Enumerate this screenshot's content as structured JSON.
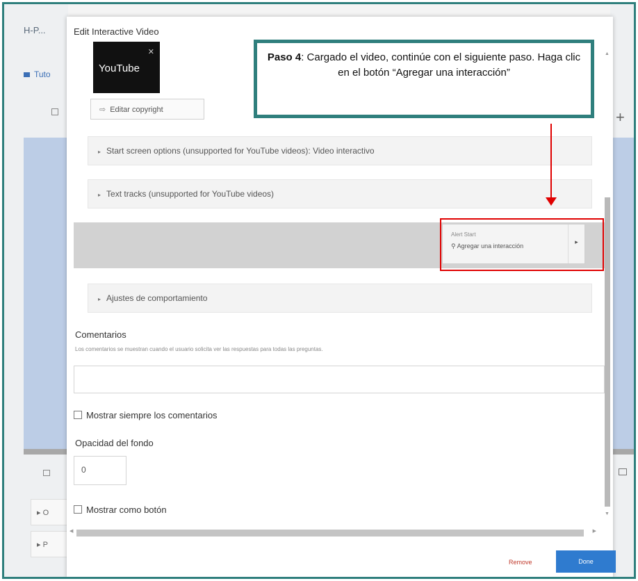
{
  "background": {
    "left_title": "H-P...",
    "left_link": "Tuto",
    "row1_text": "▸ O",
    "row2_text": "▸ P"
  },
  "dialog": {
    "title": "Edit Interactive Video",
    "youtube_label": "YouTube",
    "copyright_button": "Editar copyright",
    "accordion_start_screen": "Start screen options (unsupported for YouTube videos): Video interactivo",
    "accordion_text_tracks": "Text tracks (unsupported for YouTube videos)",
    "add_interaction_small": "Alert Start",
    "add_interaction_label": "Agregar una interacción",
    "accordion_behaviour": "Ajustes de comportamiento",
    "comments_label": "Comentarios",
    "comments_description": "Los comentarios se muestran cuando el usuario solicita ver las respuestas para todas las preguntas.",
    "comments_value": "",
    "always_show_comments": "Mostrar siempre los comentarios",
    "background_opacity_label": "Opacidad del fondo",
    "background_opacity_value": "0",
    "show_as_button": "Mostrar como botón",
    "remove_button": "Remove",
    "done_button": "Done"
  },
  "callout": {
    "bold": "Paso 4",
    "text": ": Cargado el video, continúe con el siguiente paso. Haga clic en el botón “Agregar una interacción”"
  },
  "colors": {
    "callout_border": "#2f7f7d",
    "annotation_red": "#e00000",
    "done_blue": "#2f7bcf"
  }
}
